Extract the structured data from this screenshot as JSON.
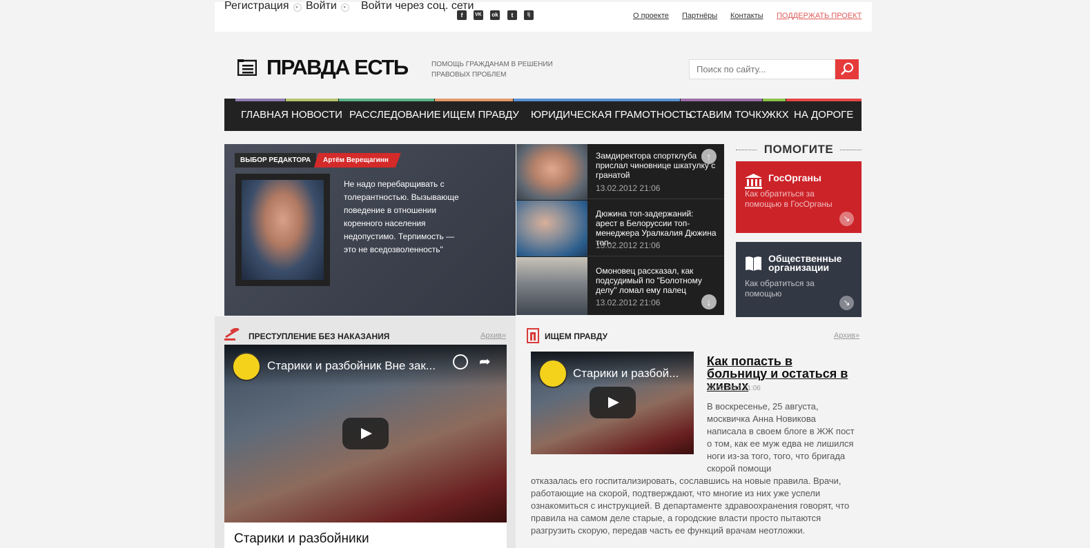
{
  "topbar": {
    "register": "Регистрация",
    "login": "Войти",
    "social_login": "Войти через соц. сети",
    "social": [
      {
        "label": "f",
        "icon": "facebook-icon"
      },
      {
        "label": "VK",
        "icon": "vk-icon"
      },
      {
        "label": "ok",
        "icon": "odnoklassniki-icon"
      },
      {
        "label": "t",
        "icon": "twitter-icon"
      },
      {
        "label": "lj",
        "icon": "livejournal-icon"
      }
    ],
    "links": [
      "О проекте",
      "Партнёры",
      "Контакты"
    ],
    "support": "ПОДДЕРЖАТЬ ПРОЕКТ",
    "support_color": "#e05a5a"
  },
  "header": {
    "logo": "ПРАВДА ЕСТЬ",
    "tagline": "ПОМОЩЬ ГРАЖДАНАМ В РЕШЕНИИ ПРАВОВЫХ ПРОБЛЕМ",
    "search_placeholder": "Поиск по сайту...",
    "accent": "#e63b3b"
  },
  "nav": [
    {
      "label": "ГЛАВНАЯ",
      "color": "#8e7db0"
    },
    {
      "label": "НОВОСТИ",
      "color": "#b5c46e"
    },
    {
      "label": "РАССЛЕДОВАНИЕ",
      "color": "#5bb58a"
    },
    {
      "label": "ИЩЕМ ПРАВДУ",
      "color": "#e39a6b"
    },
    {
      "label": "ЮРИДИЧЕСКАЯ ГРАМОТНОСТЬ",
      "color": "#5b93d4"
    },
    {
      "label": "СТАВИМ ТОЧКУ",
      "color": "#9b6fa8"
    },
    {
      "label": "ЖКХ",
      "color": "#8bc34a"
    },
    {
      "label": "НА ДОРОГЕ",
      "color": "#e54848"
    }
  ],
  "featured": {
    "label": "ВЫБОР РЕДАКТОРА",
    "author": "Артём Верещагинн",
    "text": "Не надо перебарщивать с толерантностью. Вызывающе поведение в отношении коренного населения недопустимо. Терпимость — это не вседозволенность\""
  },
  "news": [
    {
      "title": "Замдиректора спортклуба прислал чиновнице шкатулку с гранатой",
      "date": "13.02.2012 21:06"
    },
    {
      "title": "Дюжина топ-задержаний: арест в Белоруссии топ-менеджера Уралкалия Дюжина топ-",
      "date": "13.02.2012 21:06"
    },
    {
      "title": "Омоновец рассказал, как подсудимый по \"Болотному делу\" ломал ему палец",
      "date": "13.02.2012 21:06"
    }
  ],
  "help": {
    "title": "ПОМОГИТЕ",
    "boxes": [
      {
        "title": "ГосОрганы",
        "desc": "Как обратиться за помощью в ГосОрганы",
        "color": "#cc2329",
        "icon": "government-building-icon"
      },
      {
        "title": "Общественные организации",
        "desc": "Как обратиться за помощью",
        "color": "#333845",
        "icon": "open-book-icon"
      }
    ]
  },
  "section_left": {
    "title": "ПРЕСТУПЛЕНИЕ БЕЗ НАКАЗАНИЯ",
    "archive": "Архив»",
    "video_title": "Старики и разбойник Вне зак...",
    "card_title": "Старики и разбойники"
  },
  "section_right": {
    "title": "ИЩЕМ ПРАВДУ",
    "archive": "Архив»",
    "video_title": "Старики и разбой...",
    "article_title": "Как попасть в больницу и остаться в живых",
    "article_date": "13.02.2012 21:06",
    "article_p1": "В воскресенье, 25 августа, москвичка Анна Новикова написала в своем блоге в ЖЖ пост о том, как ее муж едва не лишился ноги из-за того, того, что бригада скорой помощи",
    "article_p2": "отказалась его госпитализировать, сославшись на новые правила. Врачи, работающие на скорой, подтверждают, что многие из них уже успели ознакомиться с инструкцией. В департаменте здравоохранения говорят, что правила на самом деле старые, а городские власти просто пытаются разгрузить скорую, передав часть ее функций врачам неотложки."
  }
}
